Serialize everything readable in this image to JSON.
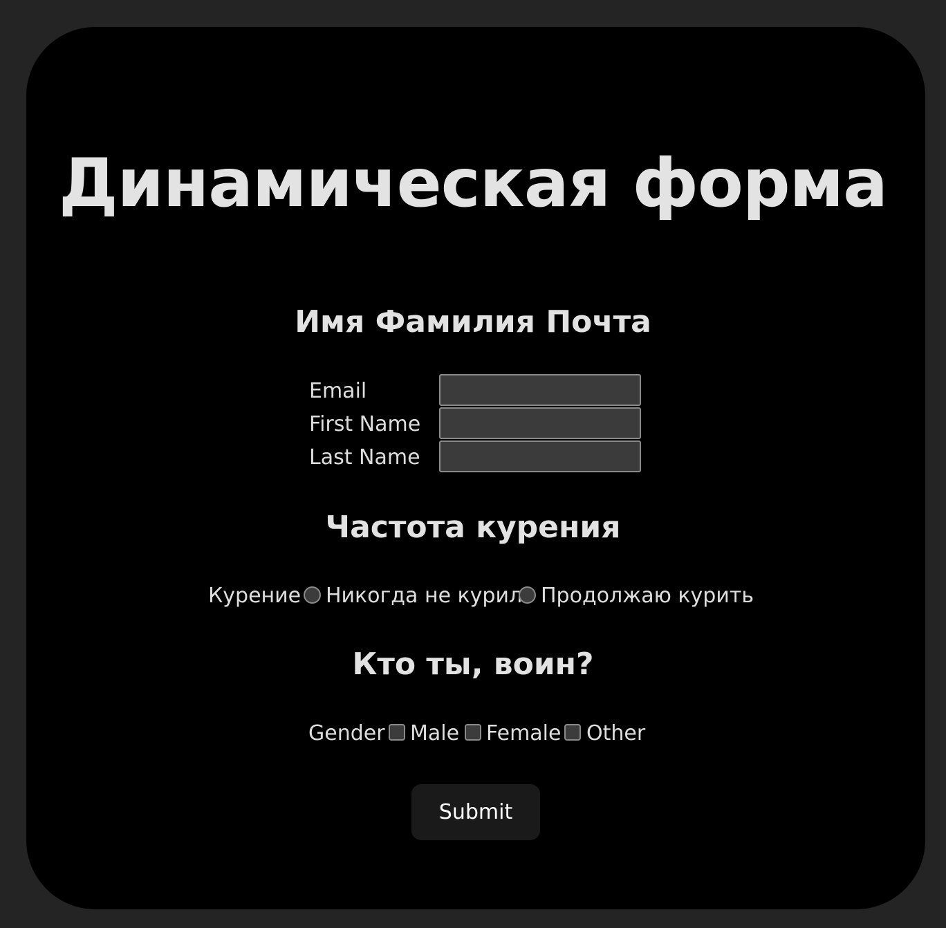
{
  "page": {
    "title": "Динамическая форма"
  },
  "sections": {
    "personal": {
      "title": "Имя Фамилия Почта"
    },
    "smoking": {
      "title": "Частота курения"
    },
    "gender": {
      "title": "Кто ты, воин?"
    }
  },
  "fields": {
    "email": {
      "label": "Email",
      "value": ""
    },
    "first_name": {
      "label": "First Name",
      "value": ""
    },
    "last_name": {
      "label": "Last Name",
      "value": ""
    }
  },
  "smoking": {
    "label": "Курение",
    "options": [
      {
        "label": "Никогда не курил",
        "selected": false
      },
      {
        "label": "Продолжаю курить",
        "selected": false
      }
    ]
  },
  "gender": {
    "label": "Gender",
    "options": [
      {
        "label": "Male",
        "checked": false
      },
      {
        "label": "Female",
        "checked": false
      },
      {
        "label": "Other",
        "checked": false
      }
    ]
  },
  "submit": {
    "label": "Submit"
  },
  "colors": {
    "page_background": "#242424",
    "card_background": "#000000",
    "text": "#e2e2e2",
    "input_background": "#3b3b3b",
    "button_background": "#1a1a1a"
  }
}
